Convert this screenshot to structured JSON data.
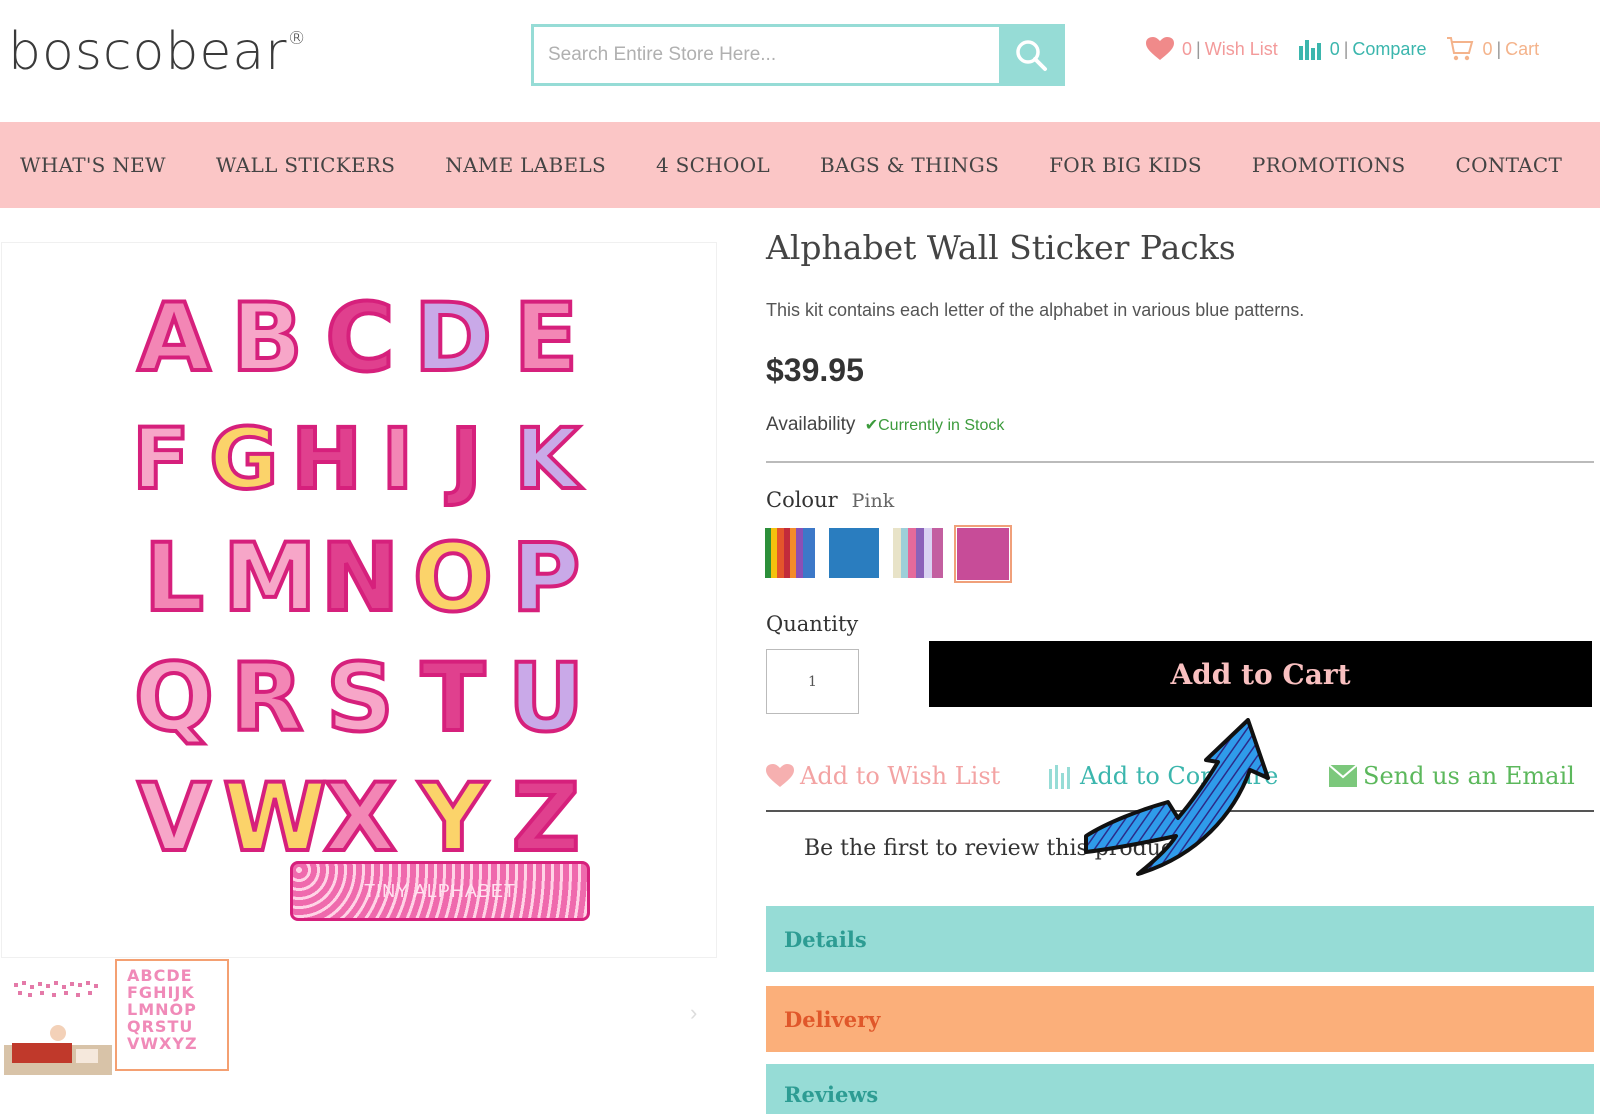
{
  "header": {
    "logo_text": "boscobear",
    "logo_mark": "®",
    "search_placeholder": "Search Entire Store Here...",
    "wishlist": {
      "count": "0",
      "label": "Wish List"
    },
    "compare": {
      "count": "0",
      "label": "Compare"
    },
    "cart": {
      "count": "0",
      "label": "Cart"
    }
  },
  "nav": {
    "items": [
      "WHAT'S NEW",
      "WALL STICKERS",
      "NAME LABELS",
      "4 SCHOOL",
      "BAGS & THINGS",
      "FOR BIG KIDS",
      "PROMOTIONS",
      "CONTACT"
    ]
  },
  "gallery": {
    "letter_rows": [
      [
        "A",
        "B",
        "C",
        "D",
        "E"
      ],
      [
        "F",
        "G",
        "H",
        "I",
        "J",
        "K"
      ],
      [
        "L",
        "M",
        "N",
        "O",
        "P"
      ],
      [
        "Q",
        "R",
        "S",
        "T",
        "U"
      ],
      [
        "V",
        "W",
        "X",
        "Y",
        "Z"
      ]
    ],
    "name_plate": "TINY ALPHABET",
    "thumb2_lines": [
      "ABCDE",
      "FGHIJK",
      "LMNOP",
      "QRSTU",
      "VWXYZ"
    ]
  },
  "product": {
    "title": "Alphabet Wall Sticker Packs",
    "description": "This kit contains each letter of the alphabet in various blue patterns.",
    "price": "$39.95",
    "availability_label": "Availability",
    "stock_status": "Currently in Stock",
    "colour_label": "Colour",
    "colour_selected": "Pink",
    "quantity_label": "Quantity",
    "quantity_value": "1",
    "add_to_cart": "Add to Cart",
    "add_to_wishlist": "Add to Wish List",
    "add_to_compare": "Add to Compare",
    "send_email": "Send us an Email",
    "review_prompt": "Be the first to review this product"
  },
  "tabs": [
    "Details",
    "Delivery",
    "Reviews"
  ],
  "colors": {
    "teal": "#96dcd6",
    "pink_nav": "#fbc6c6",
    "orange_tab": "#fbaf7a",
    "black_button": "#000000",
    "arrow_blue": "#2f9bea"
  }
}
